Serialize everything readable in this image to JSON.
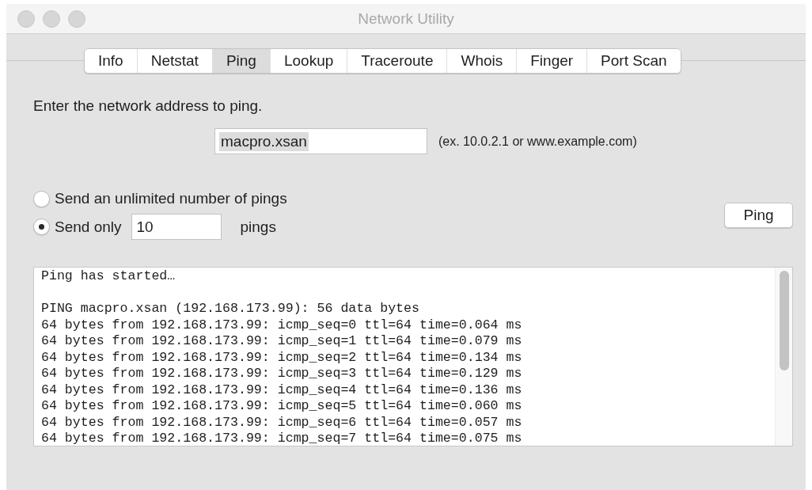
{
  "window": {
    "title": "Network Utility"
  },
  "tabs": [
    {
      "label": "Info",
      "selected": false
    },
    {
      "label": "Netstat",
      "selected": false
    },
    {
      "label": "Ping",
      "selected": true
    },
    {
      "label": "Lookup",
      "selected": false
    },
    {
      "label": "Traceroute",
      "selected": false
    },
    {
      "label": "Whois",
      "selected": false
    },
    {
      "label": "Finger",
      "selected": false
    },
    {
      "label": "Port Scan",
      "selected": false
    }
  ],
  "prompt": "Enter the network address to ping.",
  "address_field": {
    "value": "macpro.xsan",
    "text_selected": true
  },
  "address_hint": "(ex. 10.0.2.1 or www.example.com)",
  "ping_options": [
    {
      "kind": "plain",
      "label": "Send an unlimited number of pings",
      "selected": false
    },
    {
      "kind": "count",
      "label": "Send only",
      "value": "10",
      "suffix": "pings",
      "selected": true
    }
  ],
  "ping_button": "Ping",
  "output_blocks": [
    [
      "Ping has started…"
    ],
    [
      "PING macpro.xsan (192.168.173.99): 56 data bytes",
      "64 bytes from 192.168.173.99: icmp_seq=0 ttl=64 time=0.064 ms",
      "64 bytes from 192.168.173.99: icmp_seq=1 ttl=64 time=0.079 ms",
      "64 bytes from 192.168.173.99: icmp_seq=2 ttl=64 time=0.134 ms",
      "64 bytes from 192.168.173.99: icmp_seq=3 ttl=64 time=0.129 ms",
      "64 bytes from 192.168.173.99: icmp_seq=4 ttl=64 time=0.136 ms",
      "64 bytes from 192.168.173.99: icmp_seq=5 ttl=64 time=0.060 ms",
      "64 bytes from 192.168.173.99: icmp_seq=6 ttl=64 time=0.057 ms",
      "64 bytes from 192.168.173.99: icmp_seq=7 ttl=64 time=0.075 ms"
    ]
  ]
}
